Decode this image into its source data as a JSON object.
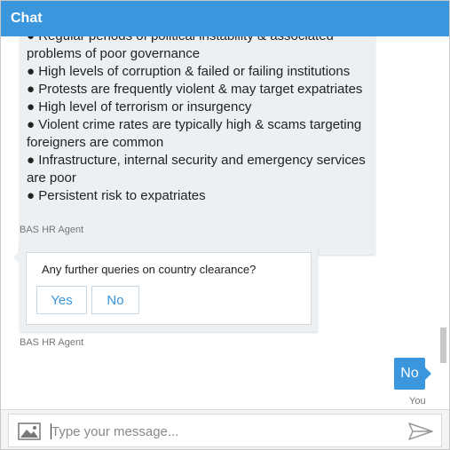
{
  "header": {
    "title": "Chat"
  },
  "messages": {
    "bot_list": [
      "● Regular periods of political instability & associated",
      "problems of poor governance",
      "● High levels of corruption & failed or failing institutions",
      "● Protests are frequently violent & may target expatriates",
      "● High level of terrorism or insurgency",
      "● Violent crime rates are typically high & scams targeting",
      "foreigners are common",
      "● Infrastructure, internal security and emergency services",
      "are poor",
      "● Persistent risk to expatriates"
    ],
    "bot_sender_1": "BAS HR Agent",
    "card": {
      "question": "Any further queries on country clearance?",
      "yes_label": "Yes",
      "no_label": "No"
    },
    "bot_sender_2": "BAS HR Agent",
    "user_reply": "No",
    "user_sender": "You"
  },
  "composer": {
    "placeholder": "Type your message...",
    "image_icon": "image-icon",
    "send_icon": "send-icon"
  },
  "colors": {
    "accent": "#3a96dd",
    "bubble_bg": "#edf0f2"
  }
}
